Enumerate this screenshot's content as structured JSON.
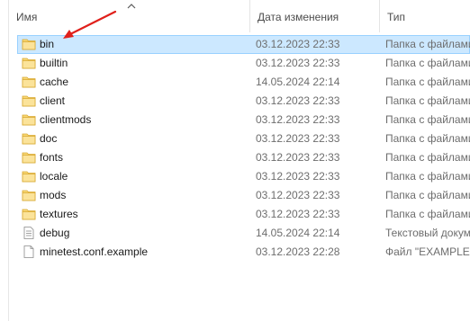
{
  "header": {
    "name_label": "Имя",
    "date_label": "Дата изменения",
    "type_label": "Тип"
  },
  "files": [
    {
      "name": "bin",
      "date": "03.12.2023 22:33",
      "type": "Папка с файлами",
      "icon": "folder-icon",
      "selected": true
    },
    {
      "name": "builtin",
      "date": "03.12.2023 22:33",
      "type": "Папка с файлами",
      "icon": "folder-icon"
    },
    {
      "name": "cache",
      "date": "14.05.2024 22:14",
      "type": "Папка с файлами",
      "icon": "folder-icon"
    },
    {
      "name": "client",
      "date": "03.12.2023 22:33",
      "type": "Папка с файлами",
      "icon": "folder-icon"
    },
    {
      "name": "clientmods",
      "date": "03.12.2023 22:33",
      "type": "Папка с файлами",
      "icon": "folder-icon"
    },
    {
      "name": "doc",
      "date": "03.12.2023 22:33",
      "type": "Папка с файлами",
      "icon": "folder-icon"
    },
    {
      "name": "fonts",
      "date": "03.12.2023 22:33",
      "type": "Папка с файлами",
      "icon": "folder-icon"
    },
    {
      "name": "locale",
      "date": "03.12.2023 22:33",
      "type": "Папка с файлами",
      "icon": "folder-icon"
    },
    {
      "name": "mods",
      "date": "03.12.2023 22:33",
      "type": "Папка с файлами",
      "icon": "folder-icon"
    },
    {
      "name": "textures",
      "date": "03.12.2023 22:33",
      "type": "Папка с файлами",
      "icon": "folder-icon"
    },
    {
      "name": "debug",
      "date": "14.05.2024 22:14",
      "type": "Текстовый документ",
      "icon": "text-file-icon"
    },
    {
      "name": "minetest.conf.example",
      "date": "03.12.2023 22:28",
      "type": "Файл \"EXAMPLE\"",
      "icon": "file-icon"
    }
  ],
  "colors": {
    "selection": "#cce8ff",
    "folder": "#f8d775",
    "annotation_arrow": "#e0201b"
  }
}
